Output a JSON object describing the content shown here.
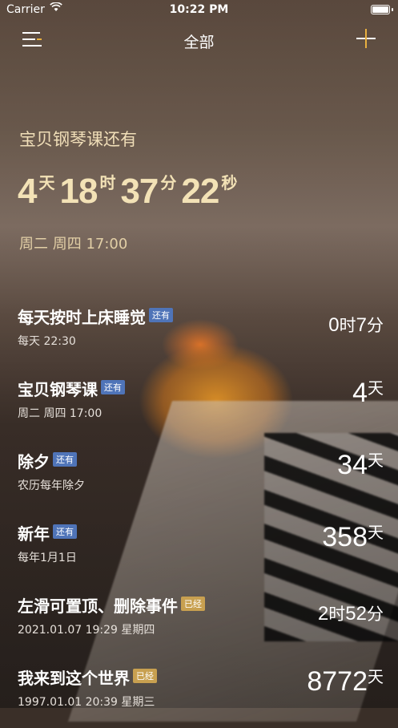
{
  "status_bar": {
    "carrier": "Carrier",
    "time": "10:22 PM"
  },
  "nav": {
    "title": "全部"
  },
  "hero": {
    "title": "宝贝钢琴课还有",
    "countdown": [
      {
        "num": "4",
        "unit": "天"
      },
      {
        "num": "18",
        "unit": "时"
      },
      {
        "num": "37",
        "unit": "分"
      },
      {
        "num": "22",
        "unit": "秒"
      }
    ],
    "schedule": "周二 周四 17:00"
  },
  "events": [
    {
      "name": "每天按时上床睡觉",
      "badge": "还有",
      "badge_color": "#4f74b8",
      "sub": "每天 22:30",
      "value": [
        {
          "n": "0",
          "u": "时"
        },
        {
          "n": "7",
          "u": "分"
        }
      ]
    },
    {
      "name": "宝贝钢琴课",
      "badge": "还有",
      "badge_color": "#4f74b8",
      "sub": "周二 周四 17:00",
      "value": [
        {
          "n": "4",
          "u": "天"
        }
      ]
    },
    {
      "name": "除夕",
      "badge": "还有",
      "badge_color": "#4f74b8",
      "sub": "农历每年除夕",
      "value": [
        {
          "n": "34",
          "u": "天"
        }
      ]
    },
    {
      "name": "新年",
      "badge": "还有",
      "badge_color": "#4f74b8",
      "sub": "每年1月1日",
      "value": [
        {
          "n": "358",
          "u": "天"
        }
      ]
    },
    {
      "name": "左滑可置顶、删除事件",
      "badge": "已经",
      "badge_color": "#c8a050",
      "sub": "2021.01.07 19:29 星期四",
      "value": [
        {
          "n": "2",
          "u": "时"
        },
        {
          "n": "52",
          "u": "分"
        }
      ]
    },
    {
      "name": "我来到这个世界",
      "badge": "已经",
      "badge_color": "#c8a050",
      "sub": "1997.01.01 20:39 星期三",
      "value": [
        {
          "n": "8772",
          "u": "天"
        }
      ]
    }
  ],
  "colors": {
    "accent": "#e8b040",
    "hero_text": "#f3e2b6",
    "badge_future": "#4f74b8",
    "badge_past": "#c8a050"
  }
}
